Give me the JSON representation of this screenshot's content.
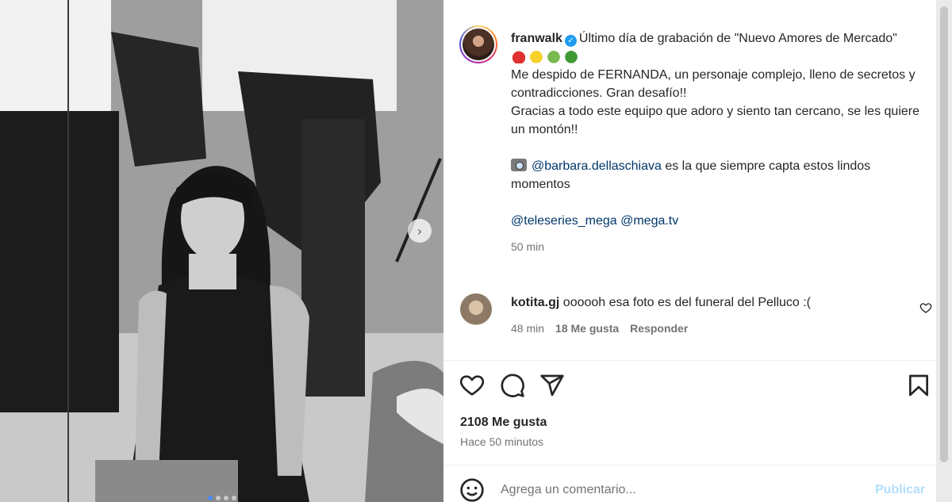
{
  "post": {
    "username": "franwalk",
    "verified_icon": "verified-badge-icon",
    "caption_title": "Último día de grabación de \"Nuevo Amores de Mercado\"",
    "caption_line2": "Me despido de FERNANDA, un personaje complejo, lleno de secretos y contradicciones. Gran desafío!!",
    "caption_line3": "Gracias a todo este equipo que adoro y siento tan cercano, se les quiere un montón!!",
    "credit_mention": "@barbara.dellaschiava",
    "credit_text": " es la que siempre capta estos lindos momentos",
    "tag1": "@teleseries_mega",
    "tag2": "@mega.tv",
    "time": "50 min"
  },
  "comment": {
    "username": "kotita.gj",
    "text": "oooooh esa foto es del funeral del Pelluco :(",
    "time": "48 min",
    "likes": "18 Me gusta",
    "reply": "Responder"
  },
  "footer": {
    "likes": "2108 Me gusta",
    "ago": "Hace 50 minutos",
    "comment_placeholder": "Agrega un comentario...",
    "publish": "Publicar"
  },
  "carousel": {
    "total_dots": 4,
    "active_index": 0
  },
  "colors": {
    "mention": "#00376b",
    "publish_disabled": "#b2dffc",
    "secondary_text": "#737373"
  }
}
